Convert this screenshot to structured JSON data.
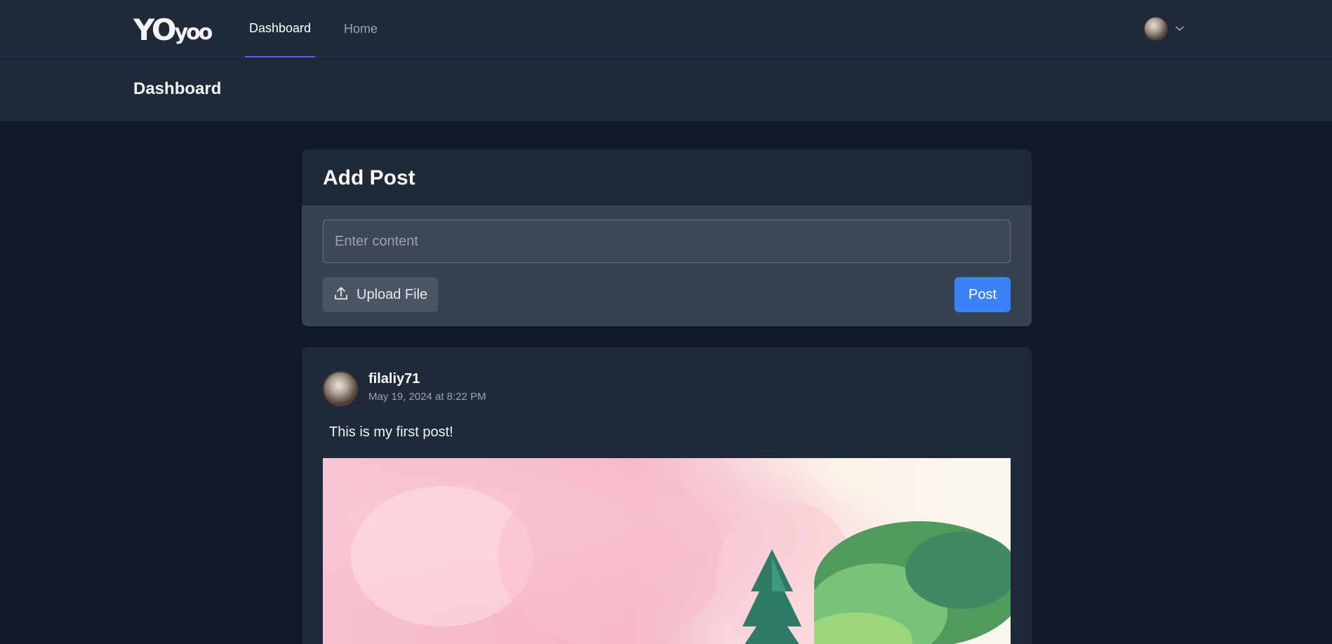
{
  "brand": {
    "logo_big": "YO",
    "logo_small": "yoo"
  },
  "nav": {
    "items": [
      {
        "label": "Dashboard",
        "active": true
      },
      {
        "label": "Home",
        "active": false
      }
    ]
  },
  "user_menu": {
    "avatar_icon": "user-avatar",
    "chevron_icon": "chevron-down-icon"
  },
  "header": {
    "title": "Dashboard"
  },
  "add_post": {
    "title": "Add Post",
    "input_placeholder": "Enter content",
    "input_value": "",
    "upload_label": "Upload File",
    "upload_icon": "upload-icon",
    "post_label": "Post"
  },
  "posts": [
    {
      "author": "filaliy71",
      "date": "May 19, 2024 at 8:22 PM",
      "text": "This is my first post!",
      "image": "pink-sky-trees-image"
    }
  ],
  "colors": {
    "background": "#111827",
    "surface": "#1f2937",
    "accent": "#6366f1",
    "primary_button": "#3b82f6"
  }
}
